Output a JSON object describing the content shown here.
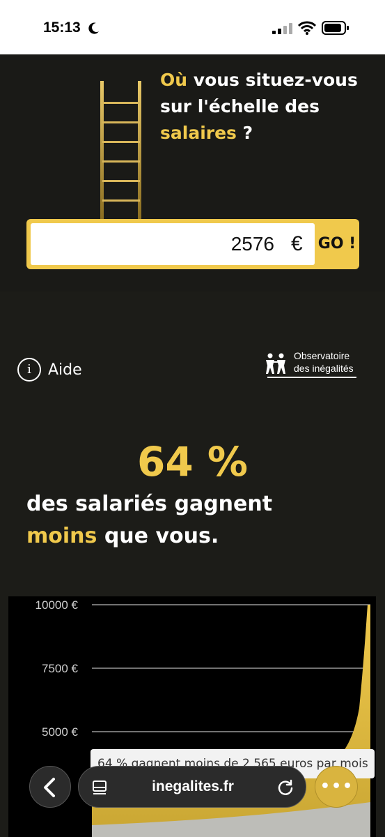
{
  "status_bar": {
    "time": "15:13"
  },
  "hero": {
    "headline_part1": "Où",
    "headline_part2": " vous situez-vous sur l'échelle des ",
    "headline_part3": "salaires",
    "headline_part4": " ?"
  },
  "salary_form": {
    "value": "2576",
    "currency": "€",
    "go_label": "GO !"
  },
  "help": {
    "icon": "i",
    "label": "Aide"
  },
  "logo": {
    "line1": "Observatoire",
    "line2": "des inégalités"
  },
  "result": {
    "percent": "64 %",
    "statement_part1": "des salariés gagnent",
    "statement_part2": "moins",
    "statement_part3": " que vous."
  },
  "chart_data": {
    "type": "area",
    "y_ticks": [
      "10000 €",
      "7500 €",
      "5000 €"
    ],
    "ylim": [
      0,
      10000
    ],
    "tooltip": "64 % gagnent moins de 2 565 euros par mois",
    "colors": {
      "fill": "#f0c94c",
      "background": "#000000"
    }
  },
  "browser": {
    "url": "inegalites.fr",
    "more_label": "•••"
  }
}
